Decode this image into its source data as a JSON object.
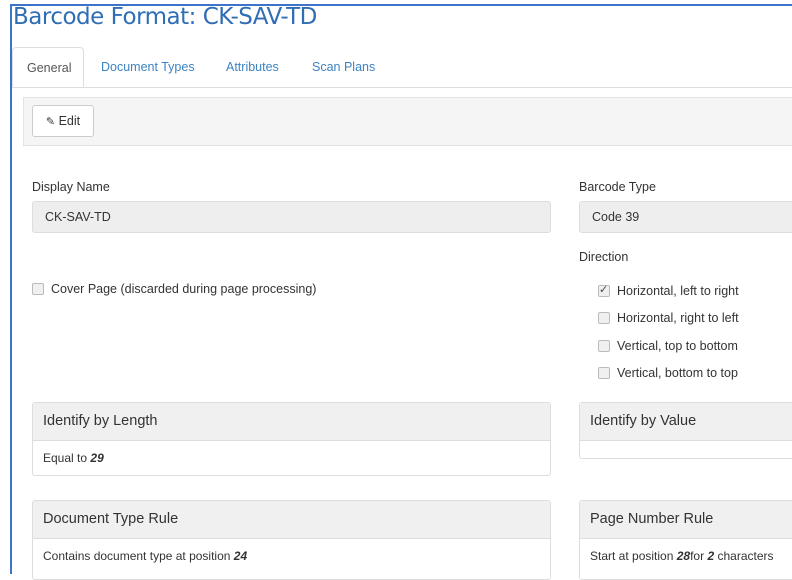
{
  "title": "Barcode Format: CK-SAV-TD",
  "tabs": [
    "General",
    "Document Types",
    "Attributes",
    "Scan Plans"
  ],
  "toolbar": {
    "edit_label": "Edit",
    "edit_icon": "edit-icon"
  },
  "display_name": {
    "label": "Display Name",
    "value": "CK-SAV-TD"
  },
  "barcode_type": {
    "label": "Barcode Type",
    "value": "Code 39"
  },
  "cover_page": {
    "label": "Cover Page (discarded during page processing)",
    "checked": false
  },
  "direction": {
    "label": "Direction",
    "options": [
      {
        "label": "Horizontal, left to right",
        "checked": true
      },
      {
        "label": "Horizontal, right to left",
        "checked": false
      },
      {
        "label": "Vertical, top to bottom",
        "checked": false
      },
      {
        "label": "Vertical, bottom to top",
        "checked": false
      }
    ]
  },
  "identify_length": {
    "title": "Identify by Length",
    "prefix": "Equal to",
    "value": "29"
  },
  "identify_value": {
    "title": "Identify by Value"
  },
  "doc_type_rule": {
    "title": "Document Type Rule",
    "prefix": "Contains document type at position",
    "position": "24"
  },
  "page_number_rule": {
    "title": "Page Number Rule",
    "prefix": "Start at position",
    "position": "28",
    "mid": "for",
    "count": "2",
    "suffix": "characters"
  },
  "colors": {
    "accent": "#3c83c3",
    "title": "#2f6db5",
    "frame": "#3d73c9"
  }
}
